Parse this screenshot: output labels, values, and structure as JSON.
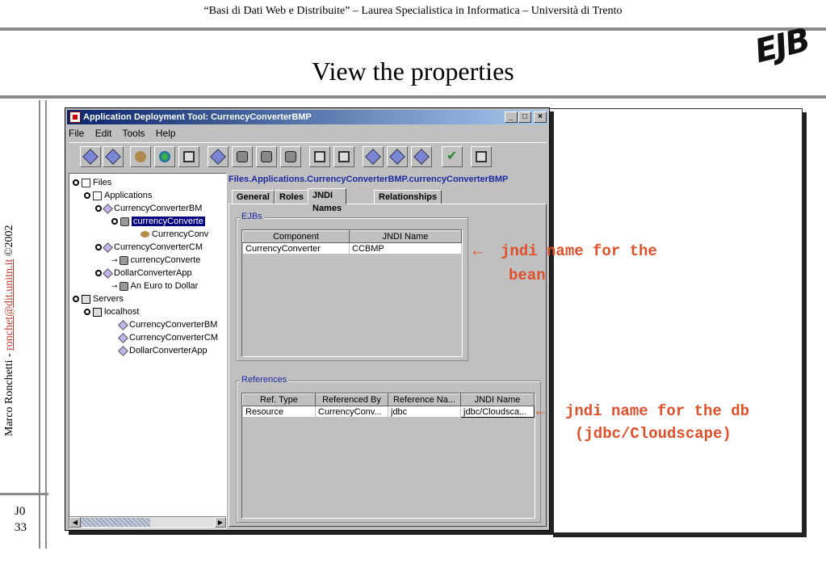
{
  "slide": {
    "header": "“Basi di Dati Web e Distribuite” – Laurea Specialistica in Informatica – Università di Trento",
    "title": "View the properties",
    "logo": "EJB",
    "author_prefix": "Marco Ronchetti - ",
    "author_email": "ronchet@dit.unitn.it",
    "author_suffix": " ©2002",
    "slide_code": "J0",
    "slide_number": "33"
  },
  "window": {
    "title": "Application Deployment Tool: CurrencyConverterBMP",
    "buttons": {
      "minimize": "_",
      "maximize": "□",
      "close": "×"
    },
    "menu": [
      "File",
      "Edit",
      "Tools",
      "Help"
    ]
  },
  "toolbar": {
    "icons": [
      "new-application-icon",
      "new-ejb-icon",
      "new-bean-icon",
      "deploy-web-icon",
      "add-component-icon",
      "deploy-icon",
      "add-db-icon",
      "remove-db-icon",
      "config-db-icon",
      "open-icon",
      "save-icon",
      "edit-icon",
      "update-icon",
      "refresh-icon",
      "verify-icon",
      "server-icon"
    ]
  },
  "tree": {
    "nodes": [
      {
        "label": "Files",
        "icon": "folder",
        "level": 0,
        "pin": true
      },
      {
        "label": "Applications",
        "icon": "folder",
        "level": 1,
        "pin": true
      },
      {
        "label": "CurrencyConverterBM",
        "icon": "diam",
        "level": 2,
        "pin": true
      },
      {
        "label": "currencyConverte",
        "icon": "drum",
        "level": 3,
        "pin": true,
        "selected": true
      },
      {
        "label": "CurrencyConv",
        "icon": "leaf",
        "level": 4,
        "pin": false
      },
      {
        "label": "CurrencyConverterCM",
        "icon": "diam",
        "level": 2,
        "pin": true
      },
      {
        "label": "currencyConverte",
        "icon": "drum",
        "level": 3,
        "pin": false,
        "key": true
      },
      {
        "label": "DollarConverterApp",
        "icon": "diam",
        "level": 2,
        "pin": true
      },
      {
        "label": "An Euro to Dollar",
        "icon": "drum",
        "level": 3,
        "pin": false,
        "key": true
      },
      {
        "label": "Servers",
        "icon": "folder",
        "level": 0,
        "pin": true
      },
      {
        "label": "localhost",
        "icon": "pc",
        "level": 1,
        "pin": true
      },
      {
        "label": "CurrencyConverterBM",
        "icon": "diam",
        "level": 2,
        "pin": false
      },
      {
        "label": "CurrencyConverterCM",
        "icon": "diam",
        "level": 2,
        "pin": false
      },
      {
        "label": "DollarConverterApp",
        "icon": "diam",
        "level": 2,
        "pin": false
      }
    ]
  },
  "details": {
    "path": "Files.Applications.CurrencyConverterBMP.currencyConverterBMP",
    "tabs": [
      "General",
      "Roles",
      "JNDI Names",
      "Relationships"
    ],
    "active_tab": "JNDI Names",
    "ejbs": {
      "title": "EJBs",
      "columns": [
        "Component",
        "JNDI Name"
      ],
      "rows": [
        [
          "CurrencyConverter",
          "CCBMP"
        ]
      ]
    },
    "references": {
      "title": "References",
      "columns": [
        "Ref. Type",
        "Referenced By",
        "Reference Na...",
        "JNDI Name"
      ],
      "rows": [
        [
          "Resource",
          "CurrencyConv...",
          "jdbc",
          "jdbc/Cloudsca..."
        ]
      ]
    }
  },
  "annotations": {
    "bean": {
      "arrow": "←",
      "line1": "jndi name for the",
      "line2": "bean"
    },
    "db": {
      "arrow": "←",
      "line1": "jndi name for the db",
      "line2": "(jdbc/Cloudscape)"
    }
  }
}
